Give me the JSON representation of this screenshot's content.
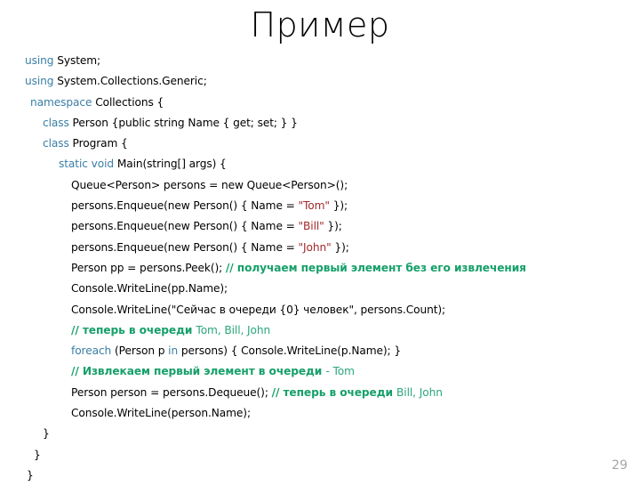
{
  "slide": {
    "title": "Пример",
    "page_number": "29",
    "colors": {
      "keyword": "#3a7fa5",
      "string": "#a3292b",
      "comment": "#16a06a",
      "comment_latin": "#2aa77a",
      "text": "#000000",
      "page_number": "#a6a6a6",
      "background": "#ffffff"
    }
  },
  "code": {
    "language": "C#",
    "lines": [
      {
        "id": "line-using-system",
        "indent": "ind-0",
        "tokens": [
          {
            "t": "kw",
            "v": "using "
          },
          {
            "t": "plain",
            "v": "System;"
          }
        ]
      },
      {
        "id": "line-using-collections-generic",
        "indent": "ind-0",
        "tokens": [
          {
            "t": "kw",
            "v": "using "
          },
          {
            "t": "plain",
            "v": "System.Collections.Generic;"
          }
        ]
      },
      {
        "id": "line-namespace",
        "indent": "ind-1",
        "tokens": [
          {
            "t": "kw",
            "v": "namespace "
          },
          {
            "t": "plain",
            "v": "Collections {"
          }
        ]
      },
      {
        "id": "line-class-person",
        "indent": "ind-2",
        "tokens": [
          {
            "t": "kw",
            "v": "class "
          },
          {
            "t": "plain",
            "v": "Person {public string Name { get; set; } }"
          }
        ]
      },
      {
        "id": "line-class-program",
        "indent": "ind-2",
        "tokens": [
          {
            "t": "kw",
            "v": "class "
          },
          {
            "t": "plain",
            "v": "Program {"
          }
        ]
      },
      {
        "id": "line-main",
        "indent": "ind-3",
        "tokens": [
          {
            "t": "kw",
            "v": "static void "
          },
          {
            "t": "plain",
            "v": "Main(string[] args) {"
          }
        ]
      },
      {
        "id": "line-queue-decl",
        "indent": "ind-4",
        "tokens": [
          {
            "t": "plain",
            "v": "Queue<Person> persons = new Queue<Person>();"
          }
        ]
      },
      {
        "id": "line-enqueue-tom",
        "indent": "ind-4",
        "tokens": [
          {
            "t": "plain",
            "v": "persons.Enqueue(new Person() { Name = "
          },
          {
            "t": "str",
            "v": "\"Tom\""
          },
          {
            "t": "plain",
            "v": " });"
          }
        ]
      },
      {
        "id": "line-enqueue-bill",
        "indent": "ind-4",
        "tokens": [
          {
            "t": "plain",
            "v": "persons.Enqueue(new Person() { Name = "
          },
          {
            "t": "str",
            "v": "\"Bill\""
          },
          {
            "t": "plain",
            "v": " });"
          }
        ]
      },
      {
        "id": "line-enqueue-john",
        "indent": "ind-4",
        "tokens": [
          {
            "t": "plain",
            "v": "persons.Enqueue(new Person() { Name = "
          },
          {
            "t": "str",
            "v": "\"John\""
          },
          {
            "t": "plain",
            "v": " });"
          }
        ]
      },
      {
        "id": "line-peek",
        "indent": "ind-4",
        "tokens": [
          {
            "t": "plain",
            "v": "Person pp = persons.Peek(); "
          },
          {
            "t": "cmt",
            "v": "// получаем первый элемент без его извлечения"
          }
        ]
      },
      {
        "id": "line-writeline-pp",
        "indent": "ind-4",
        "tokens": [
          {
            "t": "plain",
            "v": "Console.WriteLine(pp.Name);"
          }
        ]
      },
      {
        "id": "line-writeline-count",
        "indent": "ind-4",
        "tokens": [
          {
            "t": "plain",
            "v": "Console.WriteLine(\"Сейчас в очереди {0} человек\", persons.Count);"
          }
        ]
      },
      {
        "id": "line-comment-queue-now",
        "indent": "ind-4",
        "tokens": [
          {
            "t": "cmt",
            "v": "// теперь в очереди "
          },
          {
            "t": "cmt-latin",
            "v": "Tom, Bill, John"
          }
        ]
      },
      {
        "id": "line-foreach",
        "indent": "ind-4",
        "tokens": [
          {
            "t": "kw",
            "v": "foreach "
          },
          {
            "t": "plain",
            "v": "(Person p "
          },
          {
            "t": "kw",
            "v": "in "
          },
          {
            "t": "plain",
            "v": "persons) { Console.WriteLine(p.Name); }"
          }
        ]
      },
      {
        "id": "line-comment-extract",
        "indent": "ind-4",
        "tokens": [
          {
            "t": "cmt",
            "v": "// Извлекаем первый элемент в очереди "
          },
          {
            "t": "cmt-latin",
            "v": "- Tom"
          }
        ]
      },
      {
        "id": "line-dequeue",
        "indent": "ind-4",
        "tokens": [
          {
            "t": "plain",
            "v": "Person person = persons.Dequeue(); "
          },
          {
            "t": "cmt",
            "v": "// теперь в очереди "
          },
          {
            "t": "cmt-latin",
            "v": "Bill, John"
          }
        ]
      },
      {
        "id": "line-writeline-person",
        "indent": "ind-4",
        "tokens": [
          {
            "t": "plain",
            "v": "Console.WriteLine(person.Name);"
          }
        ]
      },
      {
        "id": "line-close-main",
        "indent": "ind-c2",
        "tokens": [
          {
            "t": "plain",
            "v": "}"
          }
        ]
      },
      {
        "id": "line-close-class",
        "indent": "ind-c1",
        "tokens": [
          {
            "t": "plain",
            "v": "}"
          }
        ]
      },
      {
        "id": "line-close-namespace",
        "indent": "ind-c0",
        "tokens": [
          {
            "t": "plain",
            "v": "}"
          }
        ]
      }
    ]
  }
}
